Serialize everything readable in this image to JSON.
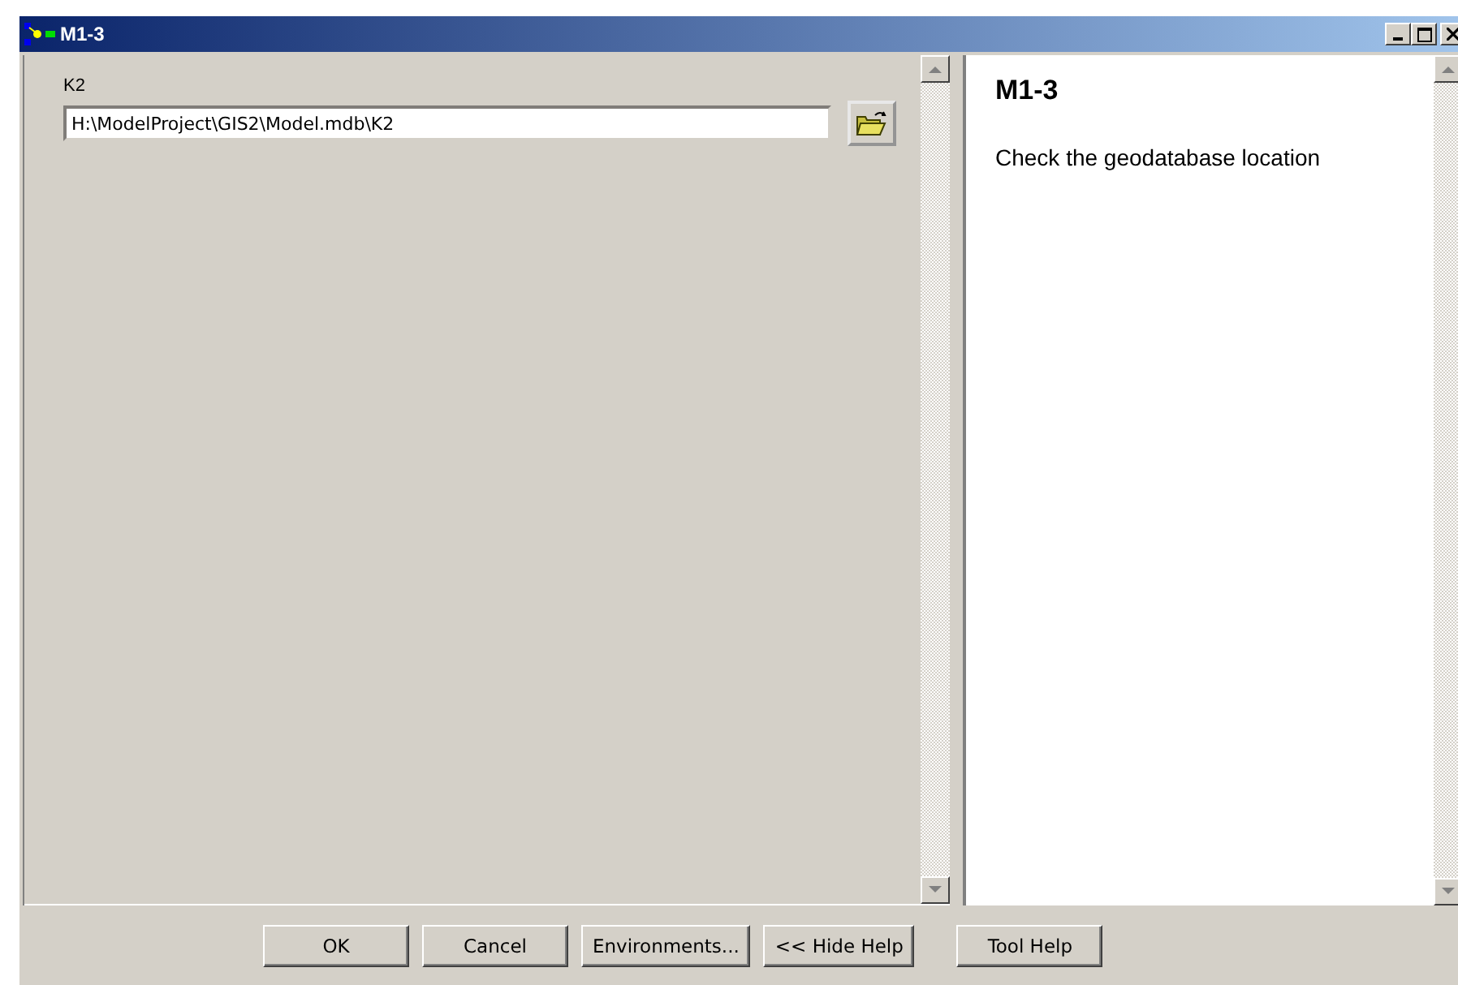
{
  "window": {
    "title": "M1-3"
  },
  "parameter": {
    "label": "K2",
    "value": "H:\\ModelProject\\GIS2\\Model.mdb\\K2"
  },
  "help": {
    "title": "M1-3",
    "text": "Check the geodatabase location"
  },
  "buttons": [
    {
      "label": "OK"
    },
    {
      "label": "Cancel"
    },
    {
      "label": "Environments..."
    },
    {
      "label": "<< Hide Help"
    },
    {
      "label": "Tool Help"
    }
  ]
}
